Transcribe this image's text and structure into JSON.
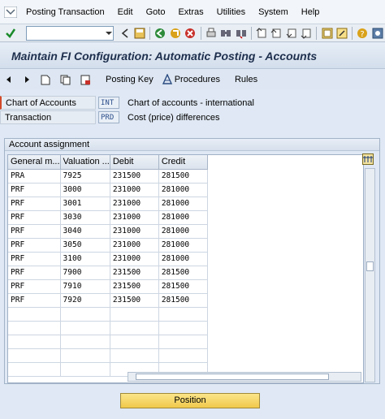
{
  "menu": {
    "items": [
      "Posting Transaction",
      "Edit",
      "Goto",
      "Extras",
      "Utilities",
      "System",
      "Help"
    ]
  },
  "toolbar": {
    "command_value": ""
  },
  "title": "Maintain FI Configuration: Automatic Posting - Accounts",
  "app_toolbar": {
    "posting_key": "Posting Key",
    "procedures": "Procedures",
    "rules": "Rules"
  },
  "fields": {
    "chart_label": "Chart of Accounts",
    "chart_value": "INT",
    "chart_desc": "Chart of accounts - international",
    "transaction_label": "Transaction",
    "transaction_value": "PRD",
    "transaction_desc": "Cost (price) differences"
  },
  "group": {
    "title": "Account assignment",
    "columns": [
      "General m...",
      "Valuation ...",
      "Debit",
      "Credit"
    ],
    "rows": [
      [
        "PRA",
        "7925",
        "231500",
        "281500"
      ],
      [
        "PRF",
        "3000",
        "231000",
        "281000"
      ],
      [
        "PRF",
        "3001",
        "231000",
        "281000"
      ],
      [
        "PRF",
        "3030",
        "231000",
        "281000"
      ],
      [
        "PRF",
        "3040",
        "231000",
        "281000"
      ],
      [
        "PRF",
        "3050",
        "231000",
        "281000"
      ],
      [
        "PRF",
        "3100",
        "231000",
        "281000"
      ],
      [
        "PRF",
        "7900",
        "231500",
        "281500"
      ],
      [
        "PRF",
        "7910",
        "231500",
        "281500"
      ],
      [
        "PRF",
        "7920",
        "231500",
        "281500"
      ]
    ]
  },
  "position_button": "Position"
}
